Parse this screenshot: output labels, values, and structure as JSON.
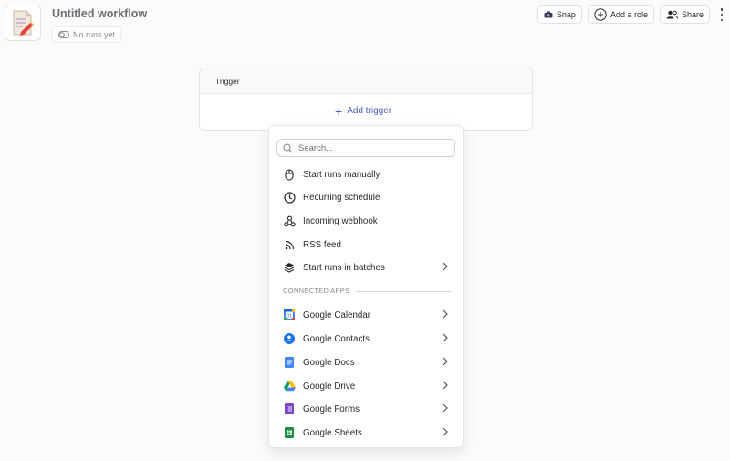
{
  "header": {
    "title": "Untitled workflow",
    "runs_status": "No runs yet",
    "app_icon": "workflow-document-icon"
  },
  "toolbar": {
    "snap_label": "Snap",
    "add_role_label": "Add a role",
    "share_label": "Share"
  },
  "trigger_card": {
    "header": "Trigger",
    "add_label": "Add trigger"
  },
  "dropdown": {
    "search_placeholder": "Search...",
    "items": [
      {
        "label": "Start runs manually",
        "icon": "mouse-icon"
      },
      {
        "label": "Recurring schedule",
        "icon": "clock-icon"
      },
      {
        "label": "Incoming webhook",
        "icon": "webhook-icon"
      },
      {
        "label": "RSS feed",
        "icon": "rss-icon"
      },
      {
        "label": "Start runs in batches",
        "icon": "layers-icon"
      }
    ],
    "section_label": "CONNECTED APPS",
    "apps": [
      {
        "label": "Google Calendar",
        "icon": "google-calendar-icon"
      },
      {
        "label": "Google Contacts",
        "icon": "google-contacts-icon"
      },
      {
        "label": "Google Docs",
        "icon": "google-docs-icon"
      },
      {
        "label": "Google Drive",
        "icon": "google-drive-icon"
      },
      {
        "label": "Google Forms",
        "icon": "google-forms-icon"
      },
      {
        "label": "Google Sheets",
        "icon": "google-sheets-icon"
      }
    ]
  },
  "colors": {
    "accent": "#4a5fc1",
    "background": "#fbfbfb",
    "calendar_blue": "#4285f4",
    "docs_blue": "#4285f4",
    "forms_purple": "#7b45c8",
    "sheets_green": "#1e8e3e"
  }
}
